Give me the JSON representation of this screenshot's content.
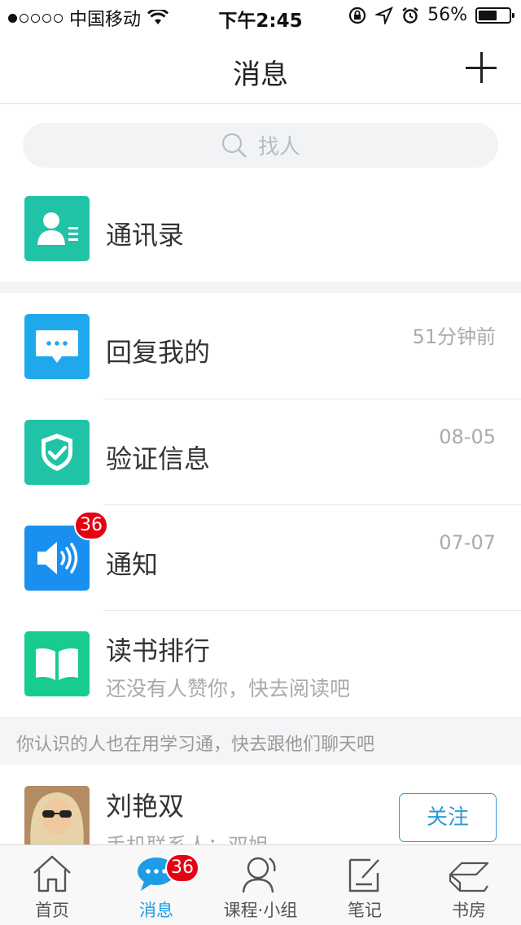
{
  "status_bar": {
    "carrier": "中国移动",
    "time": "下午2:45",
    "battery_pct": "56%",
    "battery_level": 0.56
  },
  "nav": {
    "title": "消息"
  },
  "search": {
    "placeholder": "找人"
  },
  "contacts": {
    "label": "通讯录",
    "icon": "contacts-icon",
    "color": "#20c3a6"
  },
  "messages": [
    {
      "label": "回复我的",
      "time": "51分钟前",
      "icon": "chat-bubble-icon",
      "color": "#1fa9ec"
    },
    {
      "label": "验证信息",
      "time": "08-05",
      "icon": "shield-check-icon",
      "color": "#20c3a6"
    },
    {
      "label": "通知",
      "time": "07-07",
      "icon": "speaker-icon",
      "color": "#1990f0",
      "badge": "36"
    },
    {
      "label": "读书排行",
      "subtitle": "还没有人赞你，快去阅读吧",
      "icon": "open-book-icon",
      "color": "#17cc8d"
    }
  ],
  "suggest_banner": "你认识的人也在用学习通，快去跟他们聊天吧",
  "suggested_person": {
    "name": "刘艳双",
    "subtitle": "手机联系人：双姐",
    "follow_label": "关注"
  },
  "tabbar": {
    "active_color": "#1e9de6",
    "items": [
      {
        "label": "首页",
        "icon": "home-icon"
      },
      {
        "label": "消息",
        "icon": "message-icon",
        "badge": "36",
        "active": true
      },
      {
        "label": "课程·小组",
        "icon": "person-icon"
      },
      {
        "label": "笔记",
        "icon": "note-icon"
      },
      {
        "label": "书房",
        "icon": "bookshelf-icon"
      }
    ]
  }
}
